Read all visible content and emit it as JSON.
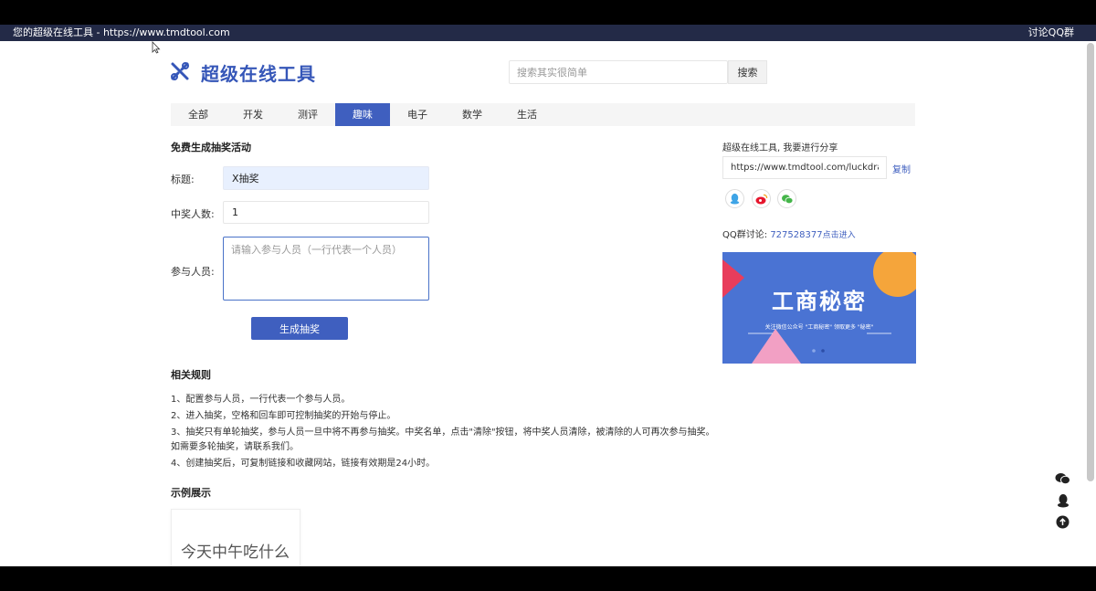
{
  "browser": {
    "title": "您的超级在线工具 - https://www.tmdtool.com",
    "right_link": "讨论QQ群"
  },
  "header": {
    "logo_text": "超级在线工具",
    "search_placeholder": "搜索其实很简单",
    "search_button": "搜索"
  },
  "tabs": [
    {
      "label": "全部"
    },
    {
      "label": "开发"
    },
    {
      "label": "测评"
    },
    {
      "label": "趣味",
      "active": true
    },
    {
      "label": "电子"
    },
    {
      "label": "数学"
    },
    {
      "label": "生活"
    }
  ],
  "form": {
    "heading": "免费生成抽奖活动",
    "title_label": "标题:",
    "title_value": "X抽奖",
    "count_label": "中奖人数:",
    "count_value": "1",
    "participants_label": "参与人员:",
    "participants_placeholder": "请输入参与人员（一行代表一个人员）",
    "generate_button": "生成抽奖"
  },
  "rules": {
    "heading": "相关规则",
    "items": [
      "1、配置参与人员，一行代表一个参与人员。",
      "2、进入抽奖，空格和回车即可控制抽奖的开始与停止。",
      "3、抽奖只有单轮抽奖，参与人员一旦中将不再参与抽奖。中奖名单，点击\"清除\"按钮，将中奖人员清除，被清除的人可再次参与抽奖。",
      "如需要多轮抽奖，请联系我们。",
      "4、创建抽奖后，可复制链接和收藏网站，链接有效期是24小时。"
    ]
  },
  "examples": {
    "heading": "示例展示",
    "card_text": "今天中午吃什么"
  },
  "share": {
    "label": "超级在线工具, 我要进行分享",
    "url": "https://www.tmdtool.com/luckdraw",
    "copy": "复制",
    "icons": [
      "qq-icon",
      "weibo-icon",
      "wechat-icon"
    ]
  },
  "qq_group": {
    "label": "QQ群讨论:",
    "number": "727528377",
    "join": "点击进入"
  },
  "banner": {
    "title": "工商秘密",
    "subtitle": "关注微信公众号 \"工商秘密\" 领取更多 \"秘密\""
  },
  "colors": {
    "accent": "#3f5fbf",
    "topbar": "#232a47",
    "banner": "#4a73d3"
  }
}
